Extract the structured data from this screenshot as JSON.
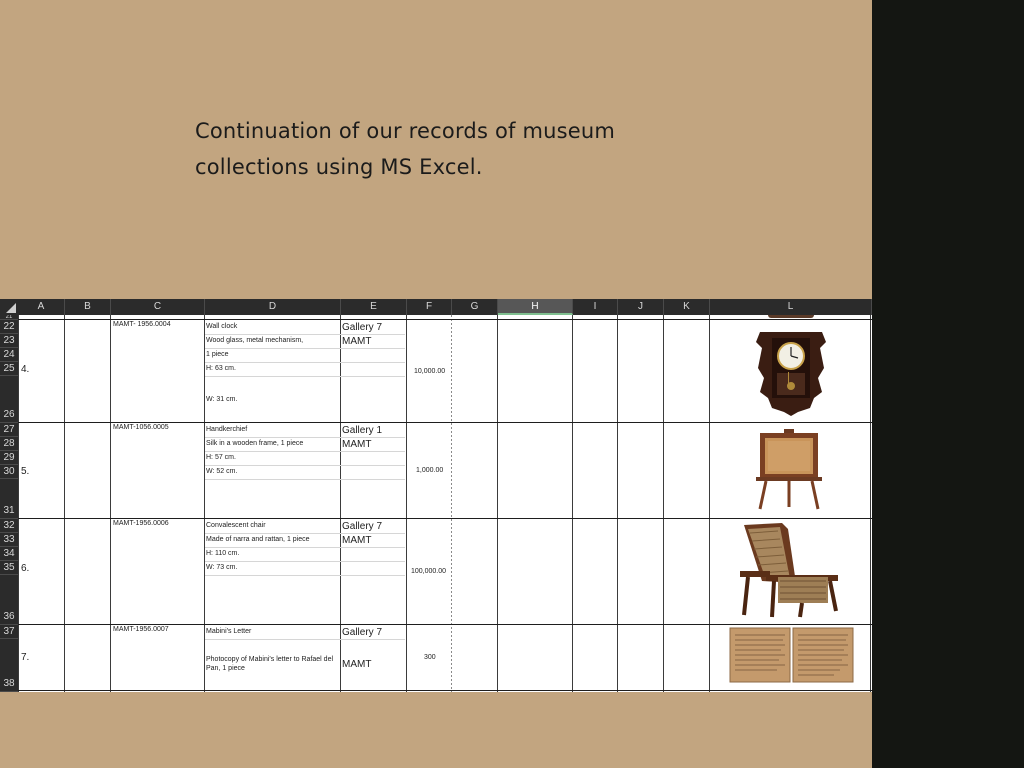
{
  "slide": {
    "heading_line1": "Continuation of our records of museum",
    "heading_line2": "collections using MS Excel."
  },
  "spreadsheet": {
    "columns": [
      "A",
      "B",
      "C",
      "D",
      "E",
      "F",
      "G",
      "H",
      "I",
      "J",
      "K",
      "L"
    ],
    "selected_column": "H",
    "row_numbers": [
      "21",
      "22",
      "23",
      "24",
      "25",
      "26",
      "27",
      "28",
      "29",
      "30",
      "31",
      "32",
      "33",
      "34",
      "35",
      "36",
      "37",
      "38"
    ],
    "records": [
      {
        "number": "4.",
        "accession": "MAMT- 1956.0004",
        "lines": [
          "Wall clock",
          "Wood glass, metal mechanism,",
          "1 piece",
          "H: 63 cm.",
          "W: 31 cm."
        ],
        "gallery": "Gallery 7",
        "location": "MAMT",
        "value": "10,000.00",
        "image_icon": "wall-clock-image"
      },
      {
        "number": "5.",
        "accession": "MAMT-1056.0005",
        "lines": [
          "Handkerchief",
          "Silk in a wooden frame, 1 piece",
          "H: 57 cm.",
          "W: 52 cm."
        ],
        "gallery": "Gallery 1",
        "location": "MAMT",
        "value": "1,000.00",
        "image_icon": "framed-handkerchief-image"
      },
      {
        "number": "6.",
        "accession": "MAMT-1956.0006",
        "lines": [
          "Convalescent chair",
          "Made of narra and rattan, 1 piece",
          "H: 110 cm.",
          "W: 73 cm."
        ],
        "gallery": "Gallery 7",
        "location": "MAMT",
        "value": "100,000.00",
        "image_icon": "convalescent-chair-image"
      },
      {
        "number": "7.",
        "accession": "MAMT-1956.0007",
        "lines": [
          "Mabini's Letter",
          "Photocopy of Mabini's letter to Rafael del",
          "Pan, 1 piece"
        ],
        "gallery": "Gallery 7",
        "location": "MAMT",
        "value": "300",
        "image_icon": "letter-image"
      }
    ]
  }
}
